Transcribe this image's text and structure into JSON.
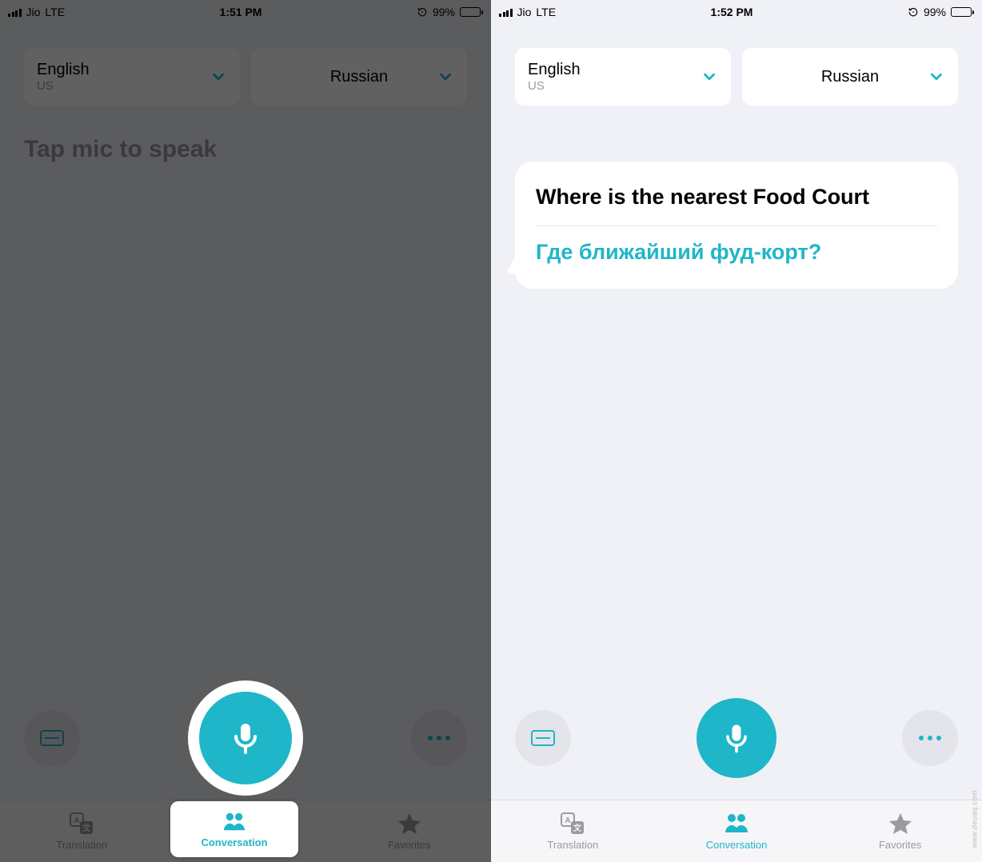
{
  "colors": {
    "accent": "#1fb6c9",
    "muted": "#9a9aa0"
  },
  "watermark": "www.deuaq.com",
  "left_screen": {
    "status": {
      "carrier": "Jio",
      "network": "LTE",
      "time": "1:51 PM",
      "battery_pct": "99%"
    },
    "source_lang": {
      "name": "English",
      "region": "US"
    },
    "target_lang": {
      "name": "Russian",
      "region": ""
    },
    "placeholder": "Tap mic to speak",
    "tabs": [
      {
        "icon": "translation-icon",
        "label": "Translation",
        "active": false
      },
      {
        "icon": "conversation-icon",
        "label": "Conversation",
        "active": true
      },
      {
        "icon": "favorites-icon",
        "label": "Favorites",
        "active": false
      }
    ]
  },
  "right_screen": {
    "status": {
      "carrier": "Jio",
      "network": "LTE",
      "time": "1:52 PM",
      "battery_pct": "99%"
    },
    "source_lang": {
      "name": "English",
      "region": "US"
    },
    "target_lang": {
      "name": "Russian",
      "region": ""
    },
    "message": {
      "source_text": "Where is the nearest Food Court",
      "target_text": "Где ближайший фуд-корт?"
    },
    "tabs": [
      {
        "icon": "translation-icon",
        "label": "Translation",
        "active": false
      },
      {
        "icon": "conversation-icon",
        "label": "Conversation",
        "active": true
      },
      {
        "icon": "favorites-icon",
        "label": "Favorites",
        "active": false
      }
    ]
  }
}
